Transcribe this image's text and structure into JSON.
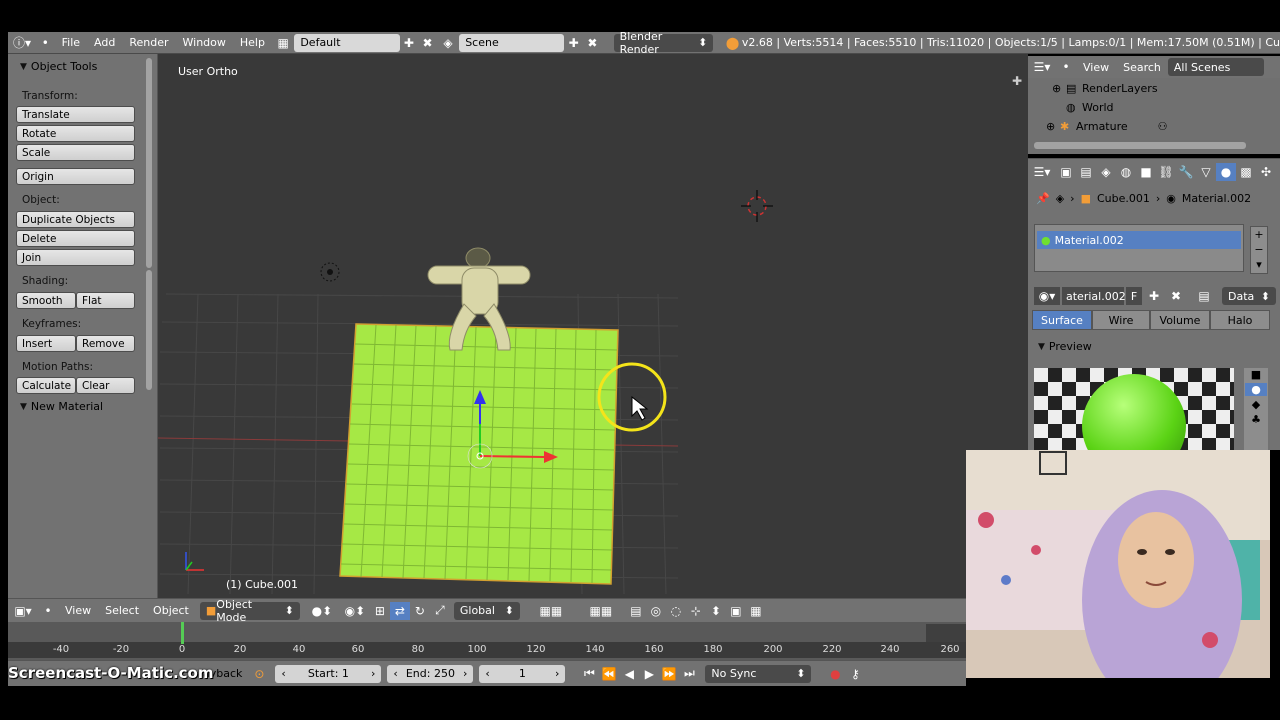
{
  "info_header": {
    "menus": [
      "File",
      "Add",
      "Render",
      "Window",
      "Help"
    ],
    "layout": "Default",
    "scene": "Scene",
    "engine": "Blender Render",
    "stats": "v2.68 | Verts:5514 | Faces:5510 | Tris:11020 | Objects:1/5 | Lamps:0/1 | Mem:17.50M (0.51M) | Cu"
  },
  "tool_shelf": {
    "title": "Object Tools",
    "transform_label": "Transform:",
    "translate": "Translate",
    "rotate": "Rotate",
    "scale": "Scale",
    "origin": "Origin",
    "object_label": "Object:",
    "duplicate": "Duplicate Objects",
    "delete": "Delete",
    "join": "Join",
    "shading_label": "Shading:",
    "smooth": "Smooth",
    "flat": "Flat",
    "keyframes_label": "Keyframes:",
    "insert": "Insert",
    "remove": "Remove",
    "motion_label": "Motion Paths:",
    "calculate": "Calculate",
    "clear": "Clear",
    "new_material": "New Material"
  },
  "viewport": {
    "view_label": "User Ortho",
    "object_label": "(1) Cube.001"
  },
  "view_header": {
    "menus": [
      "View",
      "Select",
      "Object"
    ],
    "mode": "Object Mode",
    "orientation": "Global"
  },
  "timeline": {
    "ticks": [
      "-40",
      "-20",
      "0",
      "20",
      "40",
      "60",
      "80",
      "100",
      "120",
      "140",
      "160",
      "180",
      "200",
      "220",
      "240",
      "260"
    ],
    "playback": "ayback",
    "start": "Start: 1",
    "end": "End: 250",
    "current": "1",
    "sync": "No Sync"
  },
  "outliner": {
    "view": "View",
    "search": "Search",
    "scenes": "All Scenes",
    "items": [
      "RenderLayers",
      "World",
      "Armature"
    ]
  },
  "properties": {
    "breadcrumb_object": "Cube.001",
    "breadcrumb_material": "Material.002",
    "slot_name": "Material.002",
    "material_field": "aterial.002",
    "fake_user": "F",
    "data": "Data",
    "tabs": [
      "Surface",
      "Wire",
      "Volume",
      "Halo"
    ],
    "preview": "Preview"
  },
  "watermark": "Screencast-O-Matic.com",
  "colors": {
    "accent": "#5680c2",
    "plane": "#a6e845",
    "ui_gray": "#727272"
  }
}
